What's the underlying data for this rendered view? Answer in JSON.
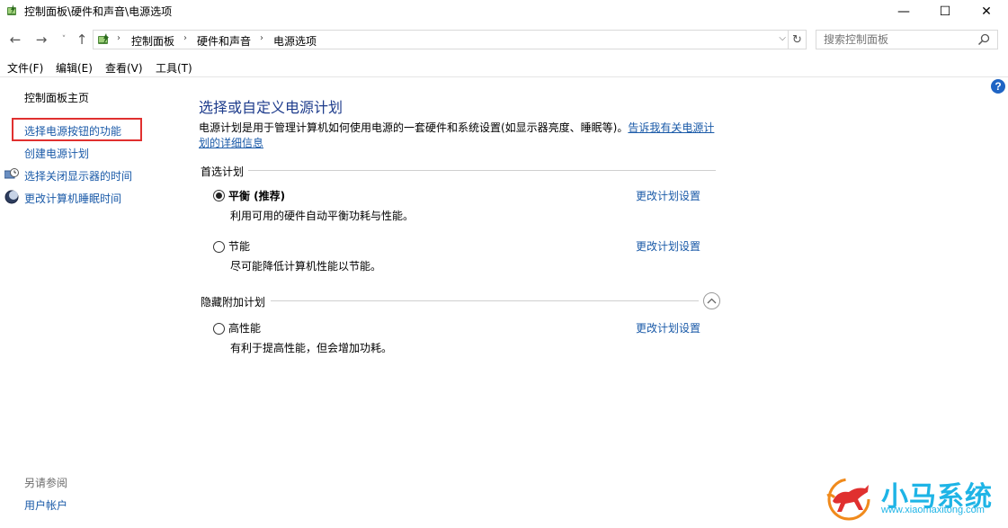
{
  "window": {
    "title": "控制面板\\硬件和声音\\电源选项",
    "minimize": "—",
    "maximize": "☐",
    "close": "✕"
  },
  "nav": {
    "back": "←",
    "forward": "→",
    "history": "˅",
    "up": "↑",
    "breadcrumbs": [
      "控制面板",
      "硬件和声音",
      "电源选项"
    ],
    "separator": "›",
    "dropdown": "⌵",
    "refresh": "↻",
    "search_placeholder": "搜索控制面板"
  },
  "menu": {
    "items": [
      "文件(F)",
      "编辑(E)",
      "查看(V)",
      "工具(T)"
    ]
  },
  "left_pane": {
    "home": "控制面板主页",
    "links": [
      "选择电源按钮的功能",
      "创建电源计划",
      "选择关闭显示器的时间",
      "更改计算机睡眠时间"
    ],
    "see_also": "另请参阅",
    "user_accounts": "用户帐户"
  },
  "main": {
    "help": "?",
    "title": "选择或自定义电源计划",
    "description": "电源计划是用于管理计算机如何使用电源的一套硬件和系统设置(如显示器亮度、睡眠等)。",
    "description_link": "告诉我有关电源计划的详细信息",
    "preferred_label": "首选计划",
    "hidden_label": "隐藏附加计划",
    "plans": [
      {
        "name": "平衡 (推荐)",
        "desc": "利用可用的硬件自动平衡功耗与性能。",
        "link": "更改计划设置",
        "selected": true
      },
      {
        "name": "节能",
        "desc": "尽可能降低计算机性能以节能。",
        "link": "更改计划设置",
        "selected": false
      },
      {
        "name": "高性能",
        "desc": "有利于提高性能，但会增加功耗。",
        "link": "更改计划设置",
        "selected": false
      }
    ]
  },
  "watermark": {
    "brand": "小马系统",
    "url": "www.xiaomaxitong.com",
    "colors": {
      "brand": "#1eb4e6",
      "horse_orange": "#f08a1c",
      "horse_red": "#e0302f"
    }
  },
  "colors": {
    "link": "#1a5aa8",
    "title": "#1e3c8c",
    "highlight": "#e0302f"
  }
}
